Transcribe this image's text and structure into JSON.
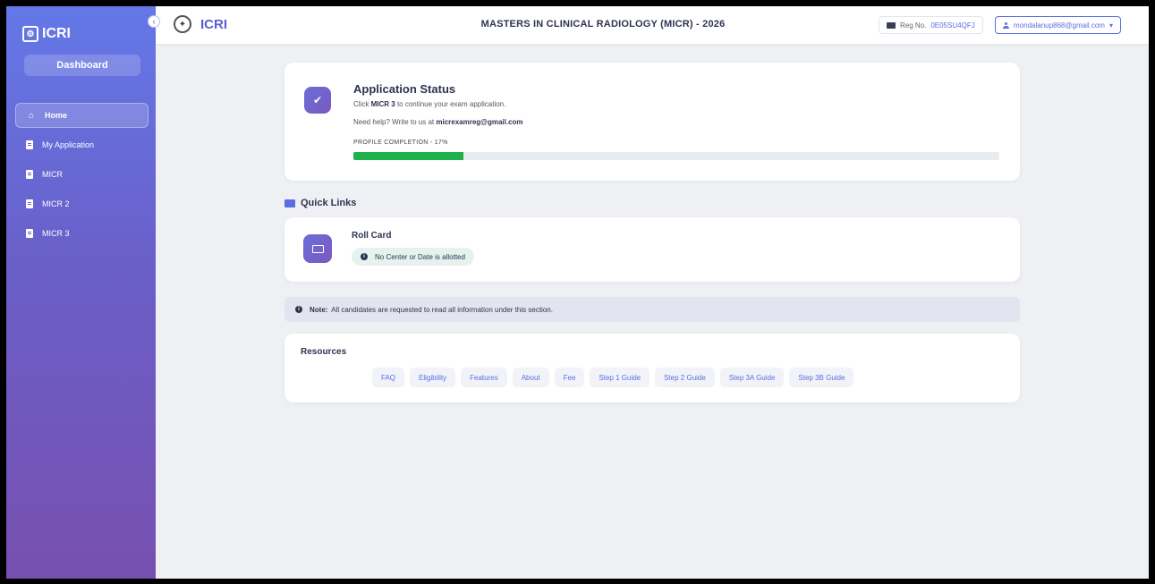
{
  "sidebar": {
    "brand": "ICRI",
    "dashboard_label": "Dashboard",
    "items": [
      {
        "label": "Home",
        "icon": "home-icon",
        "active": true
      },
      {
        "label": "My Application",
        "icon": "document-icon"
      },
      {
        "label": "MICR",
        "icon": "document-icon"
      },
      {
        "label": "MICR 2",
        "icon": "document-icon"
      },
      {
        "label": "MICR 3",
        "icon": "document-icon"
      }
    ]
  },
  "header": {
    "brand": "ICRI",
    "title": "MASTERS IN CLINICAL RADIOLOGY (MICR) - 2026",
    "reg_label": "Reg No.",
    "reg_number": "0E05SU4QFJ",
    "user_email": "mondalanup868@gmail.com",
    "user_caret": "▾"
  },
  "status": {
    "title": "Application Status",
    "line1_pre": "Click",
    "line1_bold": "MICR 3",
    "line1_post": "to continue your exam application.",
    "line2_pre": "Need help? Write to us at",
    "line2_email": "micrexamreg@gmail.com",
    "progress_label": "PROFILE COMPLETION - 17%",
    "progress_fraction": 0.17
  },
  "quick_links": {
    "title": "Quick Links",
    "roll_card": {
      "title": "Roll Card",
      "badge": "No Center or Date is allotted"
    }
  },
  "note": {
    "bold": "Note:",
    "text": "All candidates are requested to read all information under this section."
  },
  "resources": {
    "title": "Resources",
    "links": [
      "FAQ",
      "Eligibility",
      "Features",
      "About",
      "Fee",
      "Step 1 Guide",
      "Step 2 Guide",
      "Step 3A Guide",
      "Step 3B Guide"
    ]
  },
  "colors": {
    "accent": "#5a6ee0",
    "progress": "#1fb14b",
    "sidebar_top": "#6478e8",
    "sidebar_bottom": "#7750b0"
  }
}
